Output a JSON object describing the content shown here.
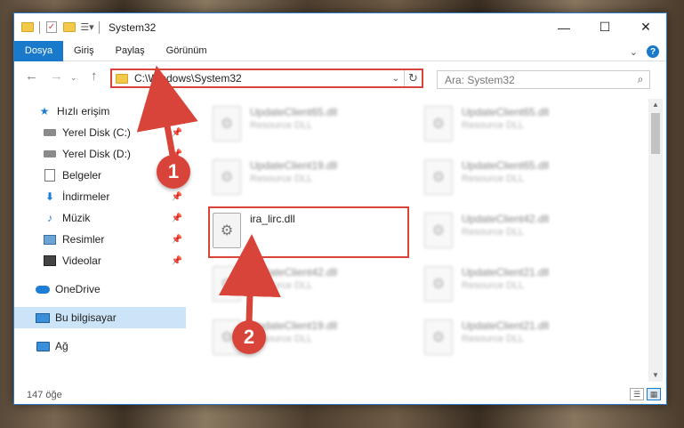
{
  "window": {
    "title": "System32",
    "controls": {
      "minimize": "—",
      "maximize": "☐",
      "close": "✕"
    }
  },
  "ribbon": {
    "tabs": [
      "Dosya",
      "Giriş",
      "Paylaş",
      "Görünüm"
    ],
    "active_tab": "Dosya",
    "expand_glyph": "⌄",
    "help_glyph": "?"
  },
  "address": {
    "path": "C:\\Windows\\System32",
    "search_placeholder": "Ara: System32"
  },
  "sidebar": {
    "items": [
      {
        "label": "Hızlı erişim",
        "icon": "star-icon",
        "pinned": false
      },
      {
        "label": "Yerel Disk (C:)",
        "icon": "drive-icon",
        "pinned": true
      },
      {
        "label": "Yerel Disk (D:)",
        "icon": "drive-icon",
        "pinned": true
      },
      {
        "label": "Belgeler",
        "icon": "document-icon",
        "pinned": true
      },
      {
        "label": "İndirmeler",
        "icon": "download-icon",
        "pinned": true
      },
      {
        "label": "Müzik",
        "icon": "music-icon",
        "pinned": true
      },
      {
        "label": "Resimler",
        "icon": "pictures-icon",
        "pinned": true
      },
      {
        "label": "Videolar",
        "icon": "videos-icon",
        "pinned": true
      },
      {
        "label": "OneDrive",
        "icon": "cloud-icon",
        "pinned": false
      },
      {
        "label": "Bu bilgisayar",
        "icon": "computer-icon",
        "pinned": false,
        "selected": true
      },
      {
        "label": "Ağ",
        "icon": "network-icon",
        "pinned": false
      }
    ]
  },
  "files": {
    "col1": [
      {
        "name": "UpdateClient65.dll",
        "type": "Resource DLL"
      },
      {
        "name": "UpdateClient19.dll",
        "type": "Resource DLL"
      },
      {
        "name": "ira_lirc.dll",
        "type": ""
      },
      {
        "name": "UpdateClient42.dll",
        "type": "Resource DLL"
      },
      {
        "name": "UpdateClient19.dll",
        "type": "Resource DLL"
      }
    ],
    "col2": [
      {
        "name": "UpdateClient65.dll",
        "type": "Resource DLL"
      },
      {
        "name": "UpdateClient65.dll",
        "type": "Resource DLL"
      },
      {
        "name": "UpdateClient42.dll",
        "type": "Resource DLL"
      },
      {
        "name": "UpdateClient21.dll",
        "type": "Resource DLL"
      },
      {
        "name": "UpdateClient21.dll",
        "type": "Resource DLL"
      }
    ]
  },
  "status": {
    "item_count": "147 öğe"
  },
  "annotations": {
    "step1": "1",
    "step2": "2",
    "color": "#d9443a"
  }
}
